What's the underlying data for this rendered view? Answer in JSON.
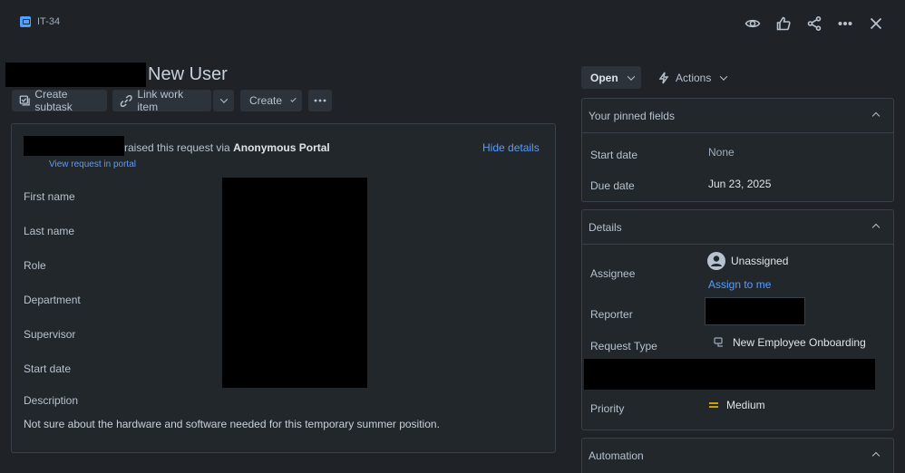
{
  "header": {
    "issue_key": "IT-34",
    "icons": [
      "eye-icon",
      "thumbs-up-icon",
      "share-icon",
      "more-icon",
      "close-icon"
    ]
  },
  "issue": {
    "title": "New User"
  },
  "toolbar": {
    "create_subtask": "Create subtask",
    "link_work_item": "Link work item",
    "create": "Create"
  },
  "request": {
    "raised_text": "raised this request via",
    "portal_name": "Anonymous Portal",
    "hide_details": "Hide details",
    "view_in_portal": "View request in portal",
    "fields": [
      "First name",
      "Last name",
      "Role",
      "Department",
      "Supervisor",
      "Start date"
    ],
    "description_label": "Description",
    "description": "Not sure about the hardware and software needed for this temporary summer position."
  },
  "sidebar": {
    "status": "Open",
    "actions": "Actions",
    "pinned": {
      "title": "Your pinned fields",
      "start_date_label": "Start date",
      "start_date_value": "None",
      "due_date_label": "Due date",
      "due_date_value": "Jun 23, 2025"
    },
    "details": {
      "title": "Details",
      "assignee_label": "Assignee",
      "assignee_value": "Unassigned",
      "assign_to_me": "Assign to me",
      "reporter_label": "Reporter",
      "request_type_label": "Request Type",
      "request_type_value": "New Employee Onboarding",
      "priority_label": "Priority",
      "priority_value": "Medium",
      "priority_color": "#e2b203"
    },
    "automation": {
      "title": "Automation"
    }
  }
}
